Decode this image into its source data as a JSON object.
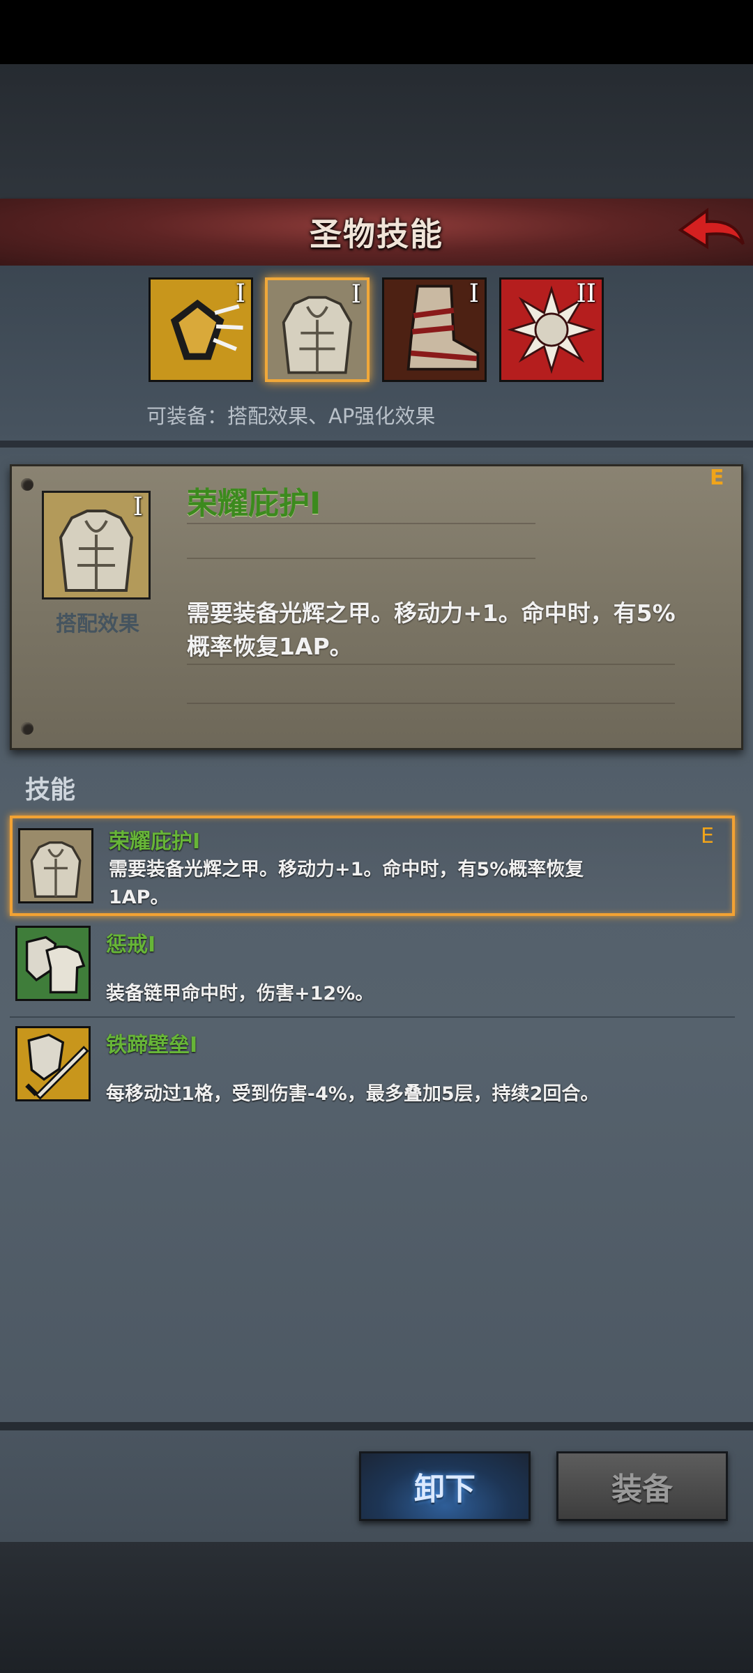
{
  "header": {
    "title": "圣物技能",
    "back_icon": "red-back-arrow-icon"
  },
  "relics": [
    {
      "name": "shield-crack-relic",
      "rank": "I",
      "bg": "#c8961c"
    },
    {
      "name": "armor-relic",
      "rank": "I",
      "bg": "#9a8b6a",
      "selected": true
    },
    {
      "name": "boot-relic",
      "rank": "I",
      "bg": "#5e2a18"
    },
    {
      "name": "sun-relic",
      "rank": "II",
      "bg": "#b51e1e"
    }
  ],
  "equippable_text": "可装备：搭配效果、AP强化效果",
  "detail": {
    "name": "荣耀庇护I",
    "grade": "E",
    "tag": "搭配效果",
    "desc_line1": "需要装备光辉之甲。移动力+1。命中时，有5%",
    "desc_line2": "概率恢复1AP。"
  },
  "skills_label": "技能",
  "skills": [
    {
      "name": "荣耀庇护I",
      "grade": "E",
      "desc_line1": "需要装备光辉之甲。移动力+1。命中时，有5%概率恢复",
      "desc_line2": "1AP。"
    },
    {
      "name": "惩戒I",
      "desc": "装备链甲命中时，伤害+12%。"
    },
    {
      "name": "铁蹄壁垒I",
      "desc": "每移动过1格，受到伤害-4%，最多叠加5层，持续2回合。"
    }
  ],
  "buttons": {
    "unequip": "卸下",
    "equip": "装备"
  }
}
